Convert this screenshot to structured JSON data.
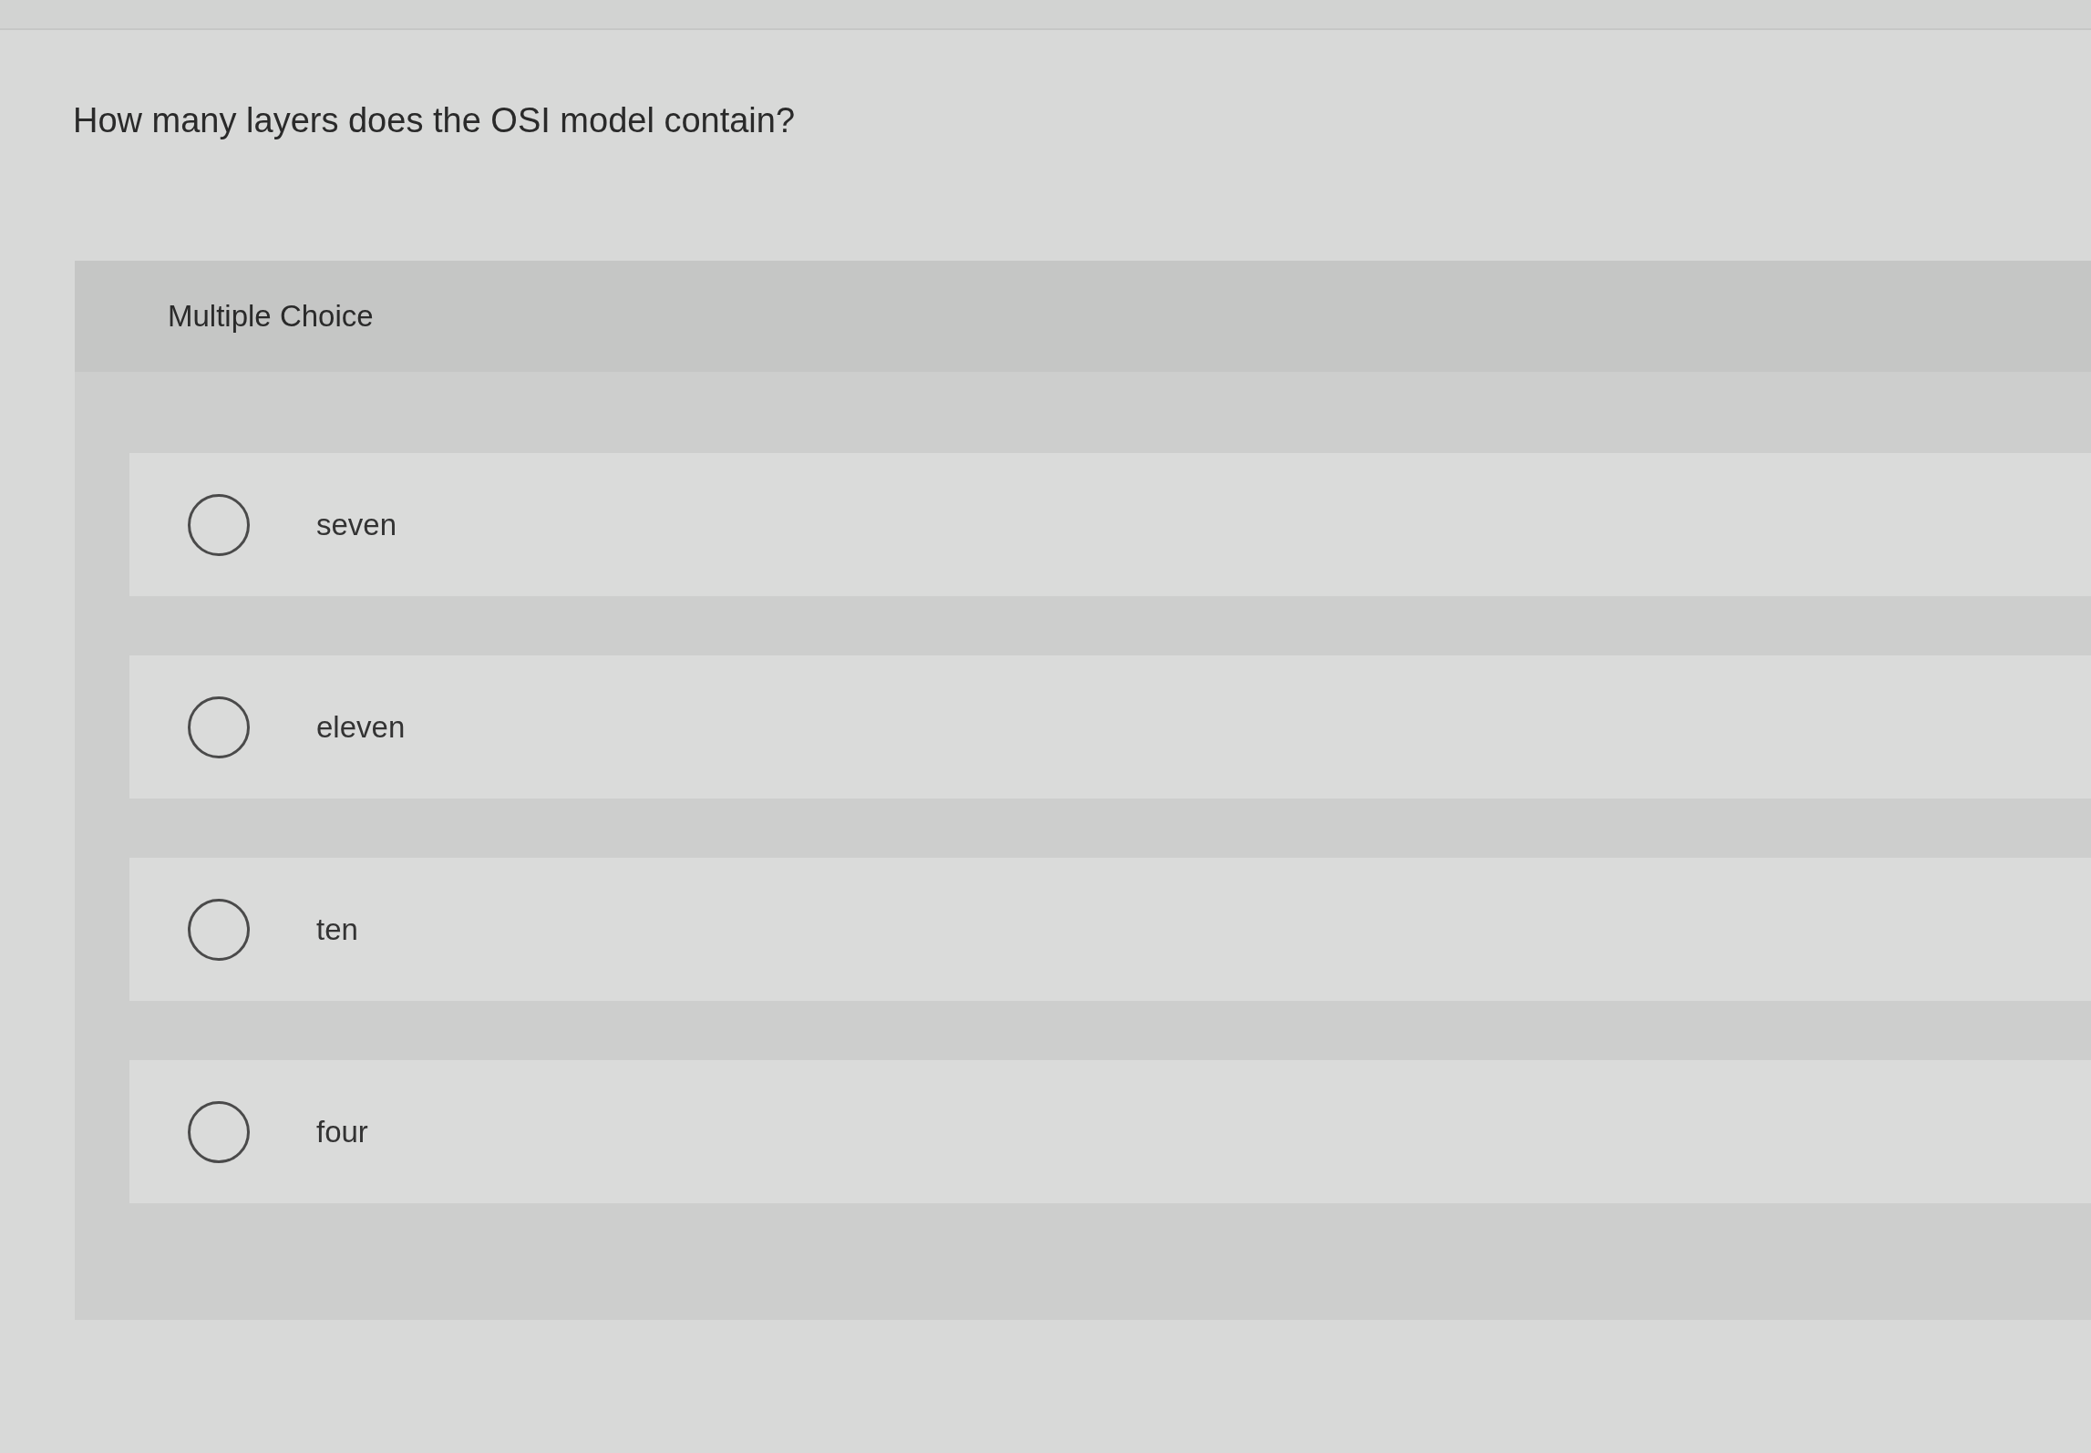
{
  "question": {
    "text": "How many layers does the OSI model contain?"
  },
  "answer_panel": {
    "heading": "Multiple Choice",
    "options": [
      {
        "label": "seven",
        "selected": false
      },
      {
        "label": "eleven",
        "selected": false
      },
      {
        "label": "ten",
        "selected": false
      },
      {
        "label": "four",
        "selected": false
      }
    ]
  }
}
